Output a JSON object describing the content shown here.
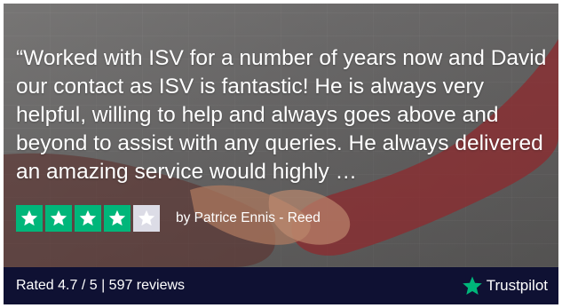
{
  "review": {
    "quote": "“Worked with ISV for a number of years now and David our contact as ISV is fantastic! He is always very helpful, willing to help and always goes above and beyond to assist with any queries. He always delivered an amazing service would highly …",
    "author": "by Patrice Ennis - Reed",
    "stars_filled": 4,
    "stars_total": 5
  },
  "footer": {
    "summary": "Rated 4.7 / 5 | 597 reviews",
    "brand_name": "Trustpilot"
  },
  "colors": {
    "star_green": "#00b67a",
    "footer_background": "#0f1133"
  },
  "icons": {
    "star": "star-icon",
    "brand": "trustpilot-star-icon"
  }
}
